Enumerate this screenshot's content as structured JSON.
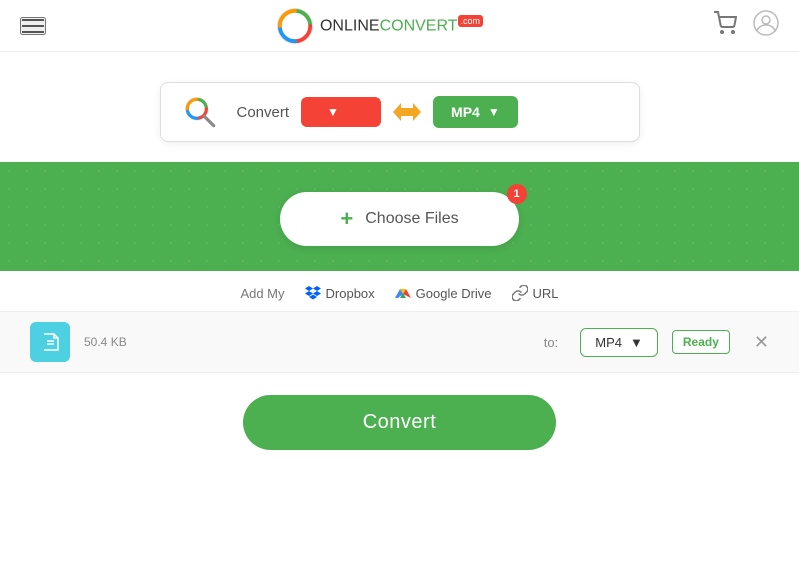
{
  "header": {
    "logo_online": "ONLINE",
    "logo_convert": "CONVERT",
    "logo_com": ".com"
  },
  "search_bar": {
    "convert_label": "Convert",
    "from_format": "",
    "to_format": "MP4",
    "from_placeholder": ""
  },
  "upload": {
    "choose_files_label": "Choose Files",
    "badge_count": "1"
  },
  "add_from": {
    "label": "Add My",
    "dropbox": "Dropbox",
    "google_drive": "Google Drive",
    "url": "URL"
  },
  "file_item": {
    "size": "50.4 KB",
    "to_label": "to:",
    "format": "MP4",
    "status": "Ready"
  },
  "convert_button": {
    "label": "Convert"
  }
}
